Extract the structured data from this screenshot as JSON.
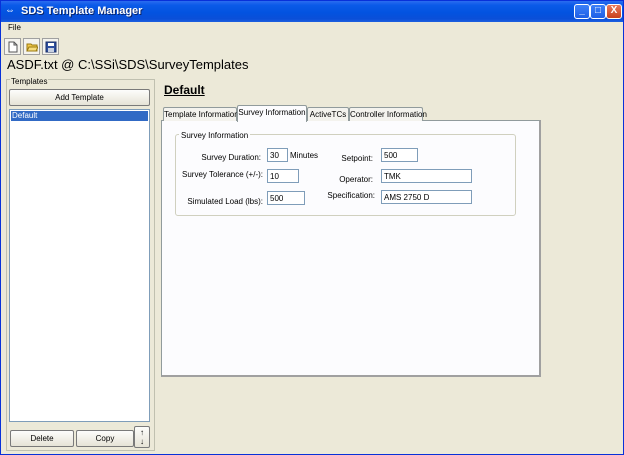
{
  "window": {
    "title": "SDS Template Manager",
    "minimize": "_",
    "maximize": "□",
    "close": "X"
  },
  "menu": {
    "file": "File"
  },
  "path_title": "ASDF.txt @ C:\\SSi\\SDS\\SurveyTemplates",
  "templates": {
    "group_label": "Templates",
    "add_button": "Add Template",
    "items": [
      "Default"
    ],
    "delete_button": "Delete",
    "copy_button": "Copy",
    "move_up": "↑",
    "move_down": "↓"
  },
  "heading": "Default",
  "tabs": [
    {
      "label": "Template Information"
    },
    {
      "label": "Survey Information"
    },
    {
      "label": "ActiveTCs"
    },
    {
      "label": "Controller Information"
    }
  ],
  "survey": {
    "group_label": "Survey Information",
    "duration_label": "Survey Duration:",
    "duration_value": "30",
    "duration_unit": "Minutes",
    "tolerance_label": "Survey Tolerance  (+/-):",
    "tolerance_value": "10",
    "load_label": "Simulated Load (lbs):",
    "load_value": "500",
    "setpoint_label": "Setpoint:",
    "setpoint_value": "500",
    "operator_label": "Operator:",
    "operator_value": "TMK",
    "spec_label": "Specification:",
    "spec_value": "AMS 2750 D"
  }
}
